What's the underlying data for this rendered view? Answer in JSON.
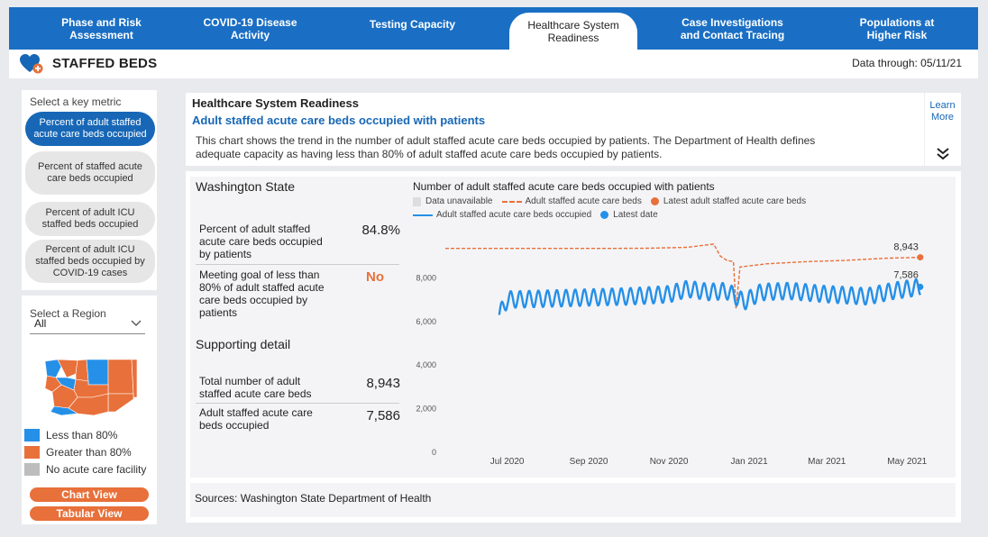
{
  "nav": {
    "tabs": [
      {
        "label_1": "Phase and Risk",
        "label_2": "Assessment"
      },
      {
        "label_1": "COVID-19 Disease",
        "label_2": "Activity"
      },
      {
        "label_1": "Testing Capacity",
        "label_2": ""
      },
      {
        "label_1": "Healthcare System",
        "label_2": "Readiness"
      },
      {
        "label_1": "Case Investigations",
        "label_2": "and Contact Tracing"
      },
      {
        "label_1": "Populations at",
        "label_2": "Higher Risk"
      }
    ]
  },
  "header": {
    "icon": "heart-plus-icon",
    "title": "STAFFED BEDS",
    "data_through": "Data through: 05/11/21"
  },
  "left_panel": {
    "select_metric_label": "Select a key metric",
    "metrics": [
      {
        "line_1": "Percent of adult staffed",
        "line_2": "acute care beds occupied",
        "line_3": ""
      },
      {
        "line_1": "Percent of staffed acute",
        "line_2": "care beds occupied",
        "line_3": ""
      },
      {
        "line_1": "Percent of adult ICU",
        "line_2": "staffed beds occupied",
        "line_3": ""
      },
      {
        "line_1": "Percent of adult ICU",
        "line_2": "staffed beds occupied by",
        "line_3": "COVID-19 cases"
      }
    ],
    "select_region_label": "Select a Region",
    "region_value": "All",
    "legend": [
      {
        "label": "Less than 80%",
        "color": "#2590e8"
      },
      {
        "label": "Greater than 80%",
        "color": "#e8703a"
      },
      {
        "label": "No acute care facility",
        "color": "#bdbdbd"
      }
    ],
    "chart_view_label": "Chart View",
    "tabular_view_label": "Tabular View"
  },
  "description": {
    "title": "Healthcare System Readiness",
    "subtitle": "Adult staffed acute care beds occupied with patients",
    "text": "This chart shows the trend in the number of adult staffed acute care beds occupied by patients. The Department of Health defines adequate capacity as having less than 80% of adult staffed acute care beds occupied by patients.",
    "learn_more_1": "Learn",
    "learn_more_2": "More"
  },
  "stats": {
    "region": "Washington State",
    "pct_label_1": "Percent of adult staffed",
    "pct_label_2": "acute care beds occupied",
    "pct_label_3": "by patients",
    "pct_value": "84.8%",
    "goal_label_1": "Meeting goal of less than",
    "goal_label_2": "80% of adult staffed acute",
    "goal_label_3": "care beds occupied by",
    "goal_label_4": "patients",
    "goal_value": "No",
    "supporting_heading": "Supporting detail",
    "total_label_1": "Total number of adult",
    "total_label_2": "staffed acute care beds",
    "total_value": "8,943",
    "occupied_label_1": "Adult staffed acute care",
    "occupied_label_2": "beds occupied",
    "occupied_value": "7,586"
  },
  "sources": "Sources: Washington State Department of Health",
  "chart_data": {
    "type": "line",
    "title": "Number of adult staffed acute care beds occupied with patients",
    "legend": {
      "unavailable": "Data unavailable",
      "staffed": "Adult staffed acute care beds",
      "latest_staffed": "Latest adult staffed acute care beds",
      "occupied": "Adult staffed acute care beds occupied",
      "latest_date": "Latest date"
    },
    "x_ticks": [
      "Jul 2020",
      "Sep 2020",
      "Nov 2020",
      "Jan 2021",
      "Mar 2021",
      "May 2021"
    ],
    "y_ticks": [
      "0",
      "2,000",
      "4,000",
      "6,000",
      "8,000"
    ],
    "ylim": [
      0,
      10000
    ],
    "x_range": [
      "2020-05-15",
      "2021-05-20"
    ],
    "series": [
      {
        "name": "Adult staffed acute care beds",
        "style": "dashed",
        "color": "#e8703a",
        "x": [
          "2020-05-15",
          "2020-06-15",
          "2020-07-15",
          "2020-08-15",
          "2020-09-15",
          "2020-10-15",
          "2020-11-15",
          "2020-12-05",
          "2020-12-10",
          "2020-12-15",
          "2020-12-20",
          "2020-12-22",
          "2020-12-25",
          "2021-01-01",
          "2021-01-15",
          "2021-02-15",
          "2021-03-15",
          "2021-04-15",
          "2021-05-11"
        ],
        "values": [
          9350,
          9350,
          9350,
          9350,
          9350,
          9360,
          9400,
          9550,
          9000,
          8800,
          8750,
          6600,
          8500,
          8550,
          8650,
          8750,
          8800,
          8900,
          8943
        ]
      },
      {
        "name": "Adult staffed acute care beds occupied",
        "style": "solid",
        "color": "#2590e8",
        "x": [
          "2020-06-25",
          "2020-07-01",
          "2020-08-01",
          "2020-09-01",
          "2020-10-01",
          "2020-11-01",
          "2020-11-15",
          "2020-12-01",
          "2020-12-15",
          "2020-12-28",
          "2021-01-10",
          "2021-02-01",
          "2021-03-01",
          "2021-04-01",
          "2021-04-20",
          "2021-05-11"
        ],
        "values": [
          6300,
          7000,
          7050,
          7100,
          7150,
          7250,
          7500,
          7350,
          7400,
          6900,
          7350,
          7400,
          7250,
          7150,
          7400,
          7586
        ]
      }
    ],
    "latest_labels": {
      "staffed": "8,943",
      "occupied": "7,586"
    }
  }
}
